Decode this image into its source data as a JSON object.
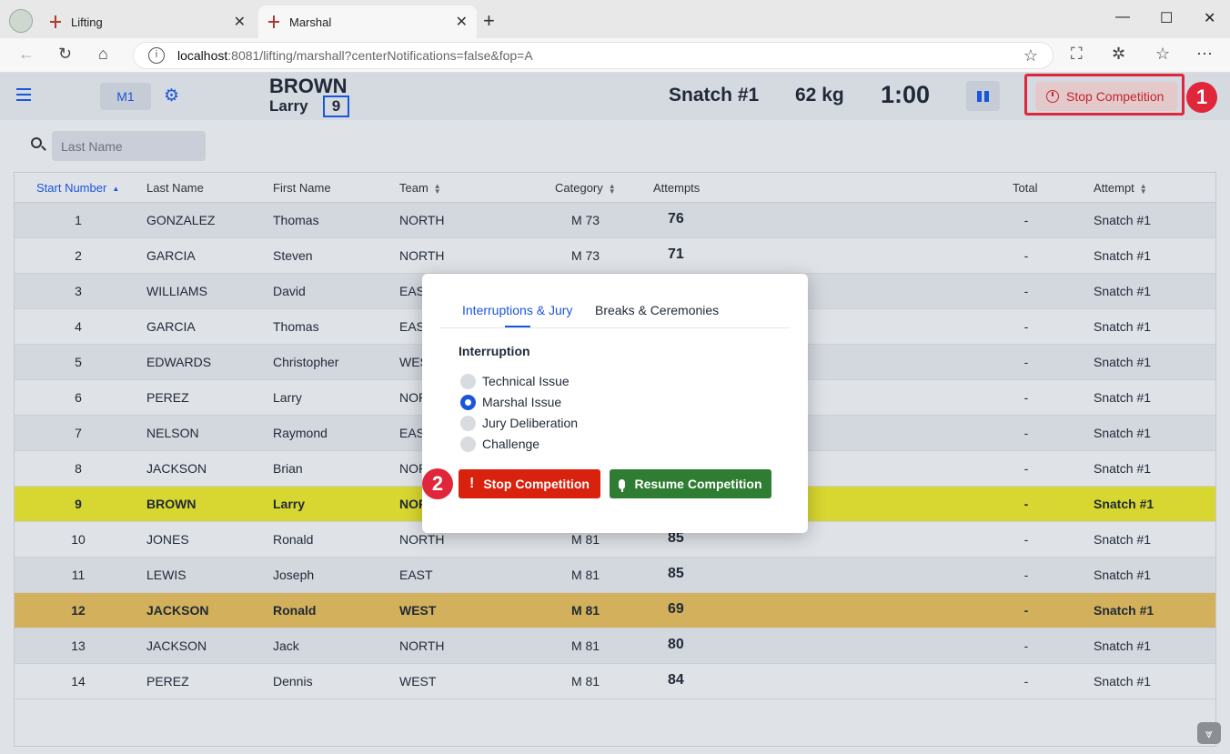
{
  "browser": {
    "tabs": [
      {
        "title": "Lifting"
      },
      {
        "title": "Marshal"
      }
    ],
    "url_host": "localhost",
    "url_path": ":8081/lifting/marshall?centerNotifications=false&fop=A"
  },
  "header": {
    "fop_label": "M1",
    "athlete_last_name": "BROWN",
    "athlete_first_name": "Larry",
    "athlete_start_number": "9",
    "attempt": "Snatch #1",
    "weight": "62 kg",
    "clock": "1:00",
    "stop_label": "Stop Competition"
  },
  "annotations": {
    "badge1": "1",
    "badge2": "2",
    "highlight_color": "#e0263a"
  },
  "search": {
    "placeholder": "Last Name"
  },
  "grid": {
    "columns": {
      "start_number": "Start Number",
      "last_name": "Last Name",
      "first_name": "First Name",
      "team": "Team",
      "category": "Category",
      "attempts": "Attempts",
      "total": "Total",
      "attempt": "Attempt"
    },
    "rows": [
      {
        "num": "1",
        "last": "GONZALEZ",
        "first": "Thomas",
        "team": "NORTH",
        "cat": "M 73",
        "a1": "76",
        "total": "-",
        "attempt": "Snatch #1"
      },
      {
        "num": "2",
        "last": "GARCIA",
        "first": "Steven",
        "team": "NORTH",
        "cat": "M 73",
        "a1": "71",
        "total": "-",
        "attempt": "Snatch #1"
      },
      {
        "num": "3",
        "last": "WILLIAMS",
        "first": "David",
        "team": "EAS",
        "cat": "",
        "a1": "",
        "total": "-",
        "attempt": "Snatch #1"
      },
      {
        "num": "4",
        "last": "GARCIA",
        "first": "Thomas",
        "team": "EAS",
        "cat": "",
        "a1": "",
        "total": "-",
        "attempt": "Snatch #1"
      },
      {
        "num": "5",
        "last": "EDWARDS",
        "first": "Christopher",
        "team": "WES",
        "cat": "",
        "a1": "",
        "total": "-",
        "attempt": "Snatch #1"
      },
      {
        "num": "6",
        "last": "PEREZ",
        "first": "Larry",
        "team": "NOR",
        "cat": "",
        "a1": "",
        "total": "-",
        "attempt": "Snatch #1"
      },
      {
        "num": "7",
        "last": "NELSON",
        "first": "Raymond",
        "team": "EAS",
        "cat": "",
        "a1": "",
        "total": "-",
        "attempt": "Snatch #1"
      },
      {
        "num": "8",
        "last": "JACKSON",
        "first": "Brian",
        "team": "NOR",
        "cat": "",
        "a1": "",
        "total": "-",
        "attempt": "Snatch #1"
      },
      {
        "num": "9",
        "last": "BROWN",
        "first": "Larry",
        "team": "NOR",
        "cat": "",
        "a1": "",
        "total": "-",
        "attempt": "Snatch #1"
      },
      {
        "num": "10",
        "last": "JONES",
        "first": "Ronald",
        "team": "NORTH",
        "cat": "M 81",
        "a1": "85",
        "total": "-",
        "attempt": "Snatch #1"
      },
      {
        "num": "11",
        "last": "LEWIS",
        "first": "Joseph",
        "team": "EAST",
        "cat": "M 81",
        "a1": "85",
        "total": "-",
        "attempt": "Snatch #1"
      },
      {
        "num": "12",
        "last": "JACKSON",
        "first": "Ronald",
        "team": "WEST",
        "cat": "M 81",
        "a1": "69",
        "total": "-",
        "attempt": "Snatch #1"
      },
      {
        "num": "13",
        "last": "JACKSON",
        "first": "Jack",
        "team": "NORTH",
        "cat": "M 81",
        "a1": "80",
        "total": "-",
        "attempt": "Snatch #1"
      },
      {
        "num": "14",
        "last": "PEREZ",
        "first": "Dennis",
        "team": "WEST",
        "cat": "M 81",
        "a1": "84",
        "total": "-",
        "attempt": "Snatch #1"
      }
    ]
  },
  "dialog": {
    "tab_interruptions": "Interruptions & Jury",
    "tab_breaks": "Breaks & Ceremonies",
    "section_title": "Interruption",
    "options": [
      {
        "label": "Technical Issue",
        "checked": false
      },
      {
        "label": "Marshal Issue",
        "checked": true
      },
      {
        "label": "Jury Deliberation",
        "checked": false
      },
      {
        "label": "Challenge",
        "checked": false
      }
    ],
    "stop_label": "Stop Competition",
    "resume_label": "Resume Competition"
  }
}
